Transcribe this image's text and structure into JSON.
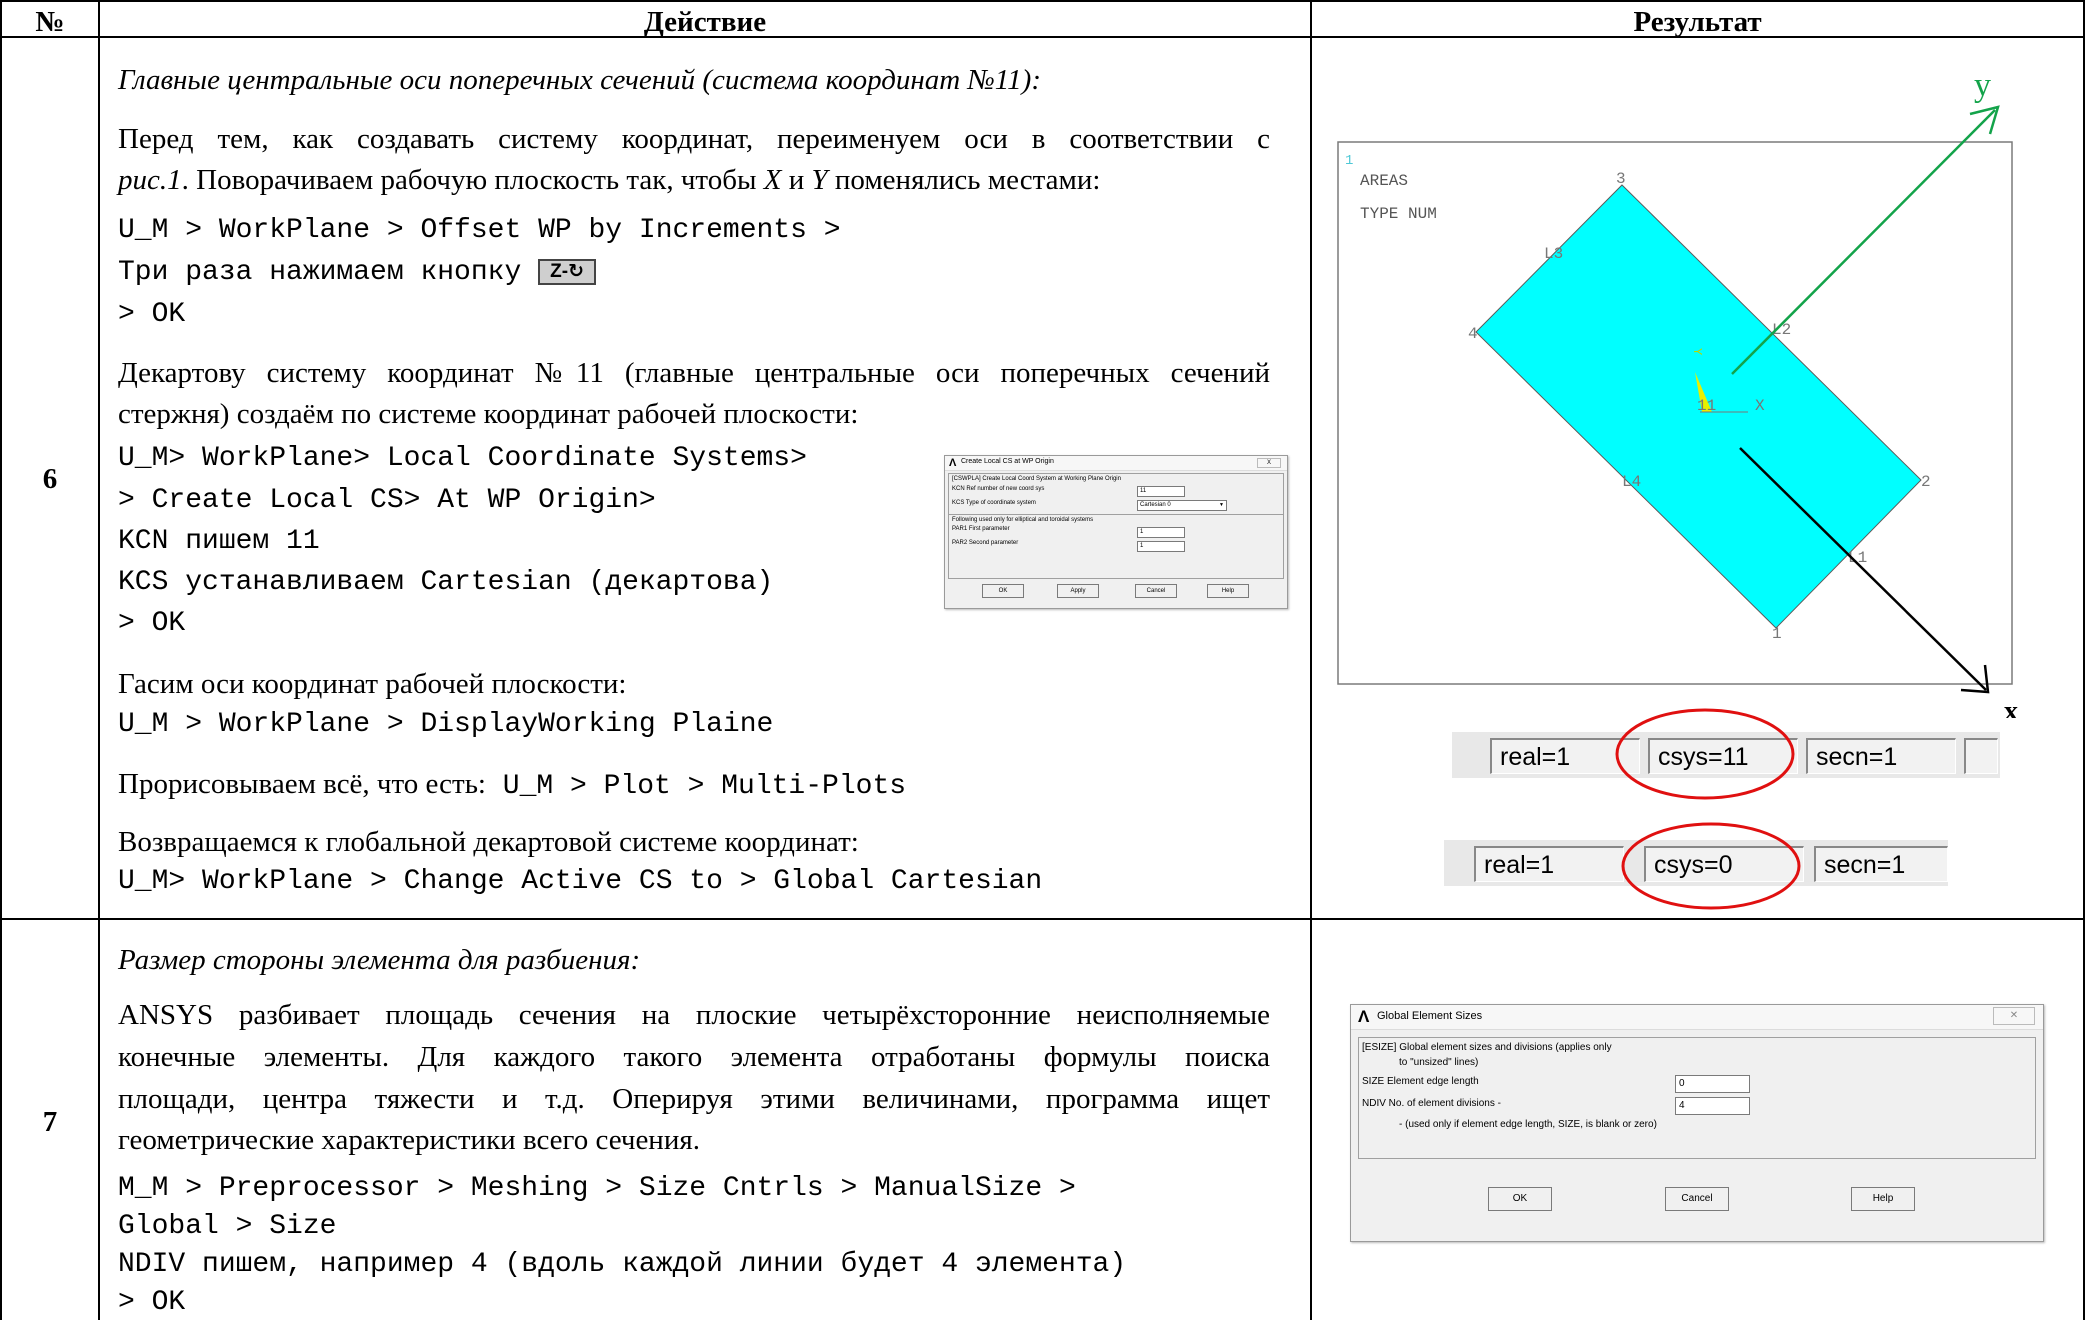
{
  "header": {
    "num": "№",
    "action": "Действие",
    "result": "Результат"
  },
  "row6": {
    "num": "6",
    "title": "Главные центральные оси поперечных сечений (система координат №11):",
    "p1_line1": "Перед тем, как создавать систему координат, переименуем оси в соответствии с",
    "p1_line2_ref": "рис.1",
    "p1_line2_mid": ". Поворачиваем рабочую плоскость так, чтобы ",
    "p1_x": "X",
    "p1_and": " и ",
    "p1_y": "Y",
    "p1_end": " поменялись местами:",
    "cmd1": "U_M > WorkPlane > Offset WP by Increments >",
    "cmd2": "Три раза нажимаем кнопку",
    "button_icon": "Z-",
    "cmd3": "> OK",
    "p2_line1": "Декартову систему координат №11 (главные центральные оси поперечных сечений",
    "p2_line2": "стержня) создаём по системе координат рабочей плоскости:",
    "cmd4": "U_M> WorkPlane> Local Coordinate Systems>",
    "cmd5": "> Create Local CS> At WP Origin>",
    "cmd6": "KCN пишем 11",
    "cmd7": "KCS устанавливаем Cartesian (декартова)",
    "cmd8": "> OK",
    "p3": "Гасим оси координат рабочей плоскости:",
    "cmd9": "U_M > WorkPlane > DisplayWorking Plaine",
    "p4": "Прорисовываем всё, что есть:",
    "p4_cmd": " U_M > Plot > Multi-Plots",
    "p5": "Возвращаемся к глобальной декартовой системе координат:",
    "cmd10": "U_M> WorkPlane > Change Active CS to > Global Cartesian",
    "dialog": {
      "title": "Create Local CS at WP Origin",
      "line1": "[CSWPLA]  Create Local Coord System at Working Plane Origin",
      "kcn_label": "KCN  Ref number of new coord sys",
      "kcn_value": "11",
      "kcs_label": "KCS  Type of coordinate system",
      "kcs_value": "Cartesian    0",
      "following": "Following used only for elliptical and toroidal systems",
      "par1_label": "PAR1  First parameter",
      "par1_value": "1",
      "par2_label": "PAR2  Second parameter",
      "par2_value": "1",
      "ok": "OK",
      "apply": "Apply",
      "cancel": "Cancel",
      "help": "Help"
    },
    "plot": {
      "corner_num": "1",
      "legend1": "AREAS",
      "legend2": "TYPE NUM",
      "kp1": "1",
      "kp2": "2",
      "kp3": "3",
      "kp4": "4",
      "l1": "L1",
      "l2": "L2",
      "l3": "L3",
      "l4": "L4",
      "cs_label": "11",
      "x_small": "X",
      "y_small": "Y",
      "axis_y": "y",
      "axis_x": "x",
      "fill_color": "#00ffff",
      "y_axis_color": "#13a34a"
    },
    "status1": {
      "real": "real=1",
      "csys": "csys=11",
      "secn": "secn=1"
    },
    "status2": {
      "real": "real=1",
      "csys": "csys=0",
      "secn": "secn=1"
    }
  },
  "row7": {
    "num": "7",
    "title": "Размер стороны элемента для разбиения:",
    "lines": [
      "ANSYS разбивает площадь сечения на плоские четырёхсторонние неисполняемые",
      "конечные элементы. Для каждого такого элемента отработаны формулы поиска",
      "площади, центра тяжести и т.д. Оперируя этими величинами, программа ищет"
    ],
    "last_line": "геометрические характеристики всего сечения.",
    "cmd1": "M_M > Preprocessor > Meshing > Size Cntrls > ManualSize >",
    "cmd2": "Global > Size",
    "cmd3": "NDIV пишем, например 4 (вдоль каждой линии будет 4 элемента)",
    "cmd4": "> OK",
    "dialog": {
      "title": "Global Element Sizes",
      "line1": "[ESIZE]  Global element sizes and divisions (applies only",
      "line2": "to \"unsized\" lines)",
      "size_label": "SIZE  Element edge length",
      "size_value": "0",
      "ndiv_label": "NDIV  No. of element divisions -",
      "ndiv_value": "4",
      "note": "- (used only if element edge length, SIZE, is blank or zero)",
      "ok": "OK",
      "cancel": "Cancel",
      "help": "Help"
    }
  }
}
